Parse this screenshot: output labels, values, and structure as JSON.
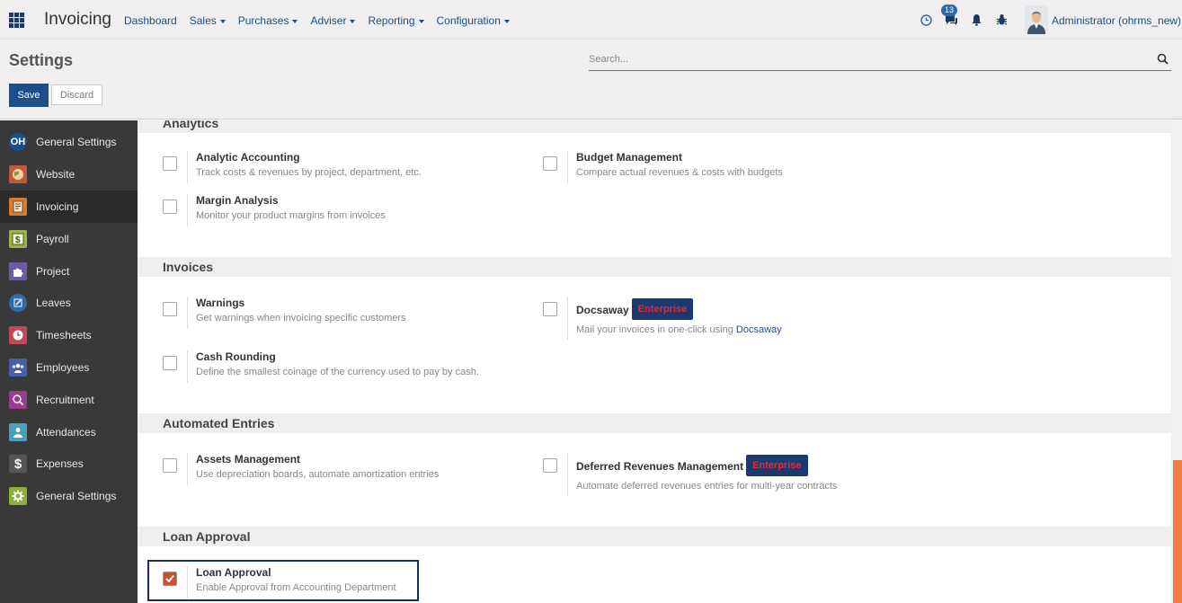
{
  "app": {
    "title": "Invoicing"
  },
  "menu": [
    {
      "label": "Dashboard",
      "dropdown": false
    },
    {
      "label": "Sales",
      "dropdown": true
    },
    {
      "label": "Purchases",
      "dropdown": true
    },
    {
      "label": "Adviser",
      "dropdown": true
    },
    {
      "label": "Reporting",
      "dropdown": true
    },
    {
      "label": "Configuration",
      "dropdown": true
    }
  ],
  "systray": {
    "messages_count": "13",
    "user_name": "Administrator (ohrms_new)"
  },
  "control_panel": {
    "title": "Settings",
    "search_placeholder": "Search...",
    "save_label": "Save",
    "discard_label": "Discard"
  },
  "sidebar": {
    "items": [
      {
        "label": "General Settings",
        "icon": "oh-icon",
        "color": "#3a68a8",
        "active": false
      },
      {
        "label": "Website",
        "icon": "globe-icon",
        "color": "#c05a3c",
        "active": false
      },
      {
        "label": "Invoicing",
        "icon": "invoice-icon",
        "color": "#d47b3a",
        "active": true
      },
      {
        "label": "Payroll",
        "icon": "payroll-icon",
        "color": "#9cb346",
        "active": false
      },
      {
        "label": "Project",
        "icon": "puzzle-icon",
        "color": "#6e5ba8",
        "active": false
      },
      {
        "label": "Leaves",
        "icon": "leaves-icon",
        "color": "#2e6ba8",
        "active": false
      },
      {
        "label": "Timesheets",
        "icon": "clock-icon",
        "color": "#c0485a",
        "active": false
      },
      {
        "label": "Employees",
        "icon": "people-icon",
        "color": "#4a5ea8",
        "active": false
      },
      {
        "label": "Recruitment",
        "icon": "recruit-icon",
        "color": "#9a3c8c",
        "active": false
      },
      {
        "label": "Attendances",
        "icon": "attendance-icon",
        "color": "#4aa0b4",
        "active": false
      },
      {
        "label": "Expenses",
        "icon": "dollar-icon",
        "color": "#555555",
        "active": false
      },
      {
        "label": "General Settings",
        "icon": "gear-icon",
        "color": "#8ab03a",
        "active": false
      }
    ]
  },
  "sections": {
    "analytics": {
      "title": "Analytics",
      "analytic_accounting": {
        "title": "Analytic Accounting",
        "desc": "Track costs & revenues by project, department, etc."
      },
      "budget_management": {
        "title": "Budget Management",
        "desc": "Compare actual revenues & costs with budgets"
      },
      "margin_analysis": {
        "title": "Margin Analysis",
        "desc": "Monitor your product margins from invoices"
      }
    },
    "invoices": {
      "title": "Invoices",
      "warnings": {
        "title": "Warnings",
        "desc": "Get warnings when invoicing specific customers"
      },
      "docsaway": {
        "title": "Docsaway",
        "badge": "Enterprise",
        "desc_prefix": "Mail your invoices in one-click using",
        "desc_link": "Docsaway"
      },
      "cash_rounding": {
        "title": "Cash Rounding",
        "desc": "Define the smallest coinage of the currency used to pay by cash."
      }
    },
    "automated_entries": {
      "title": "Automated Entries",
      "assets_management": {
        "title": "Assets Management",
        "desc": "Use depreciation boards, automate amortization entries"
      },
      "deferred_revenues": {
        "title": "Deferred Revenues Management",
        "badge": "Enterprise",
        "desc": "Automate deferred revenues entries for multi-year contracts"
      }
    },
    "loan_approval": {
      "title": "Loan Approval",
      "loan_approval": {
        "title": "Loan Approval",
        "desc": "Enable Approval from Accounting Department",
        "checked": true
      }
    }
  },
  "colors": {
    "accent": "#1c4f8a",
    "checkbox_checked": "#c8502e",
    "enterprise_bg": "#1d3a6d",
    "enterprise_text": "#e52838",
    "scroll_thumb": "#f07e45"
  }
}
